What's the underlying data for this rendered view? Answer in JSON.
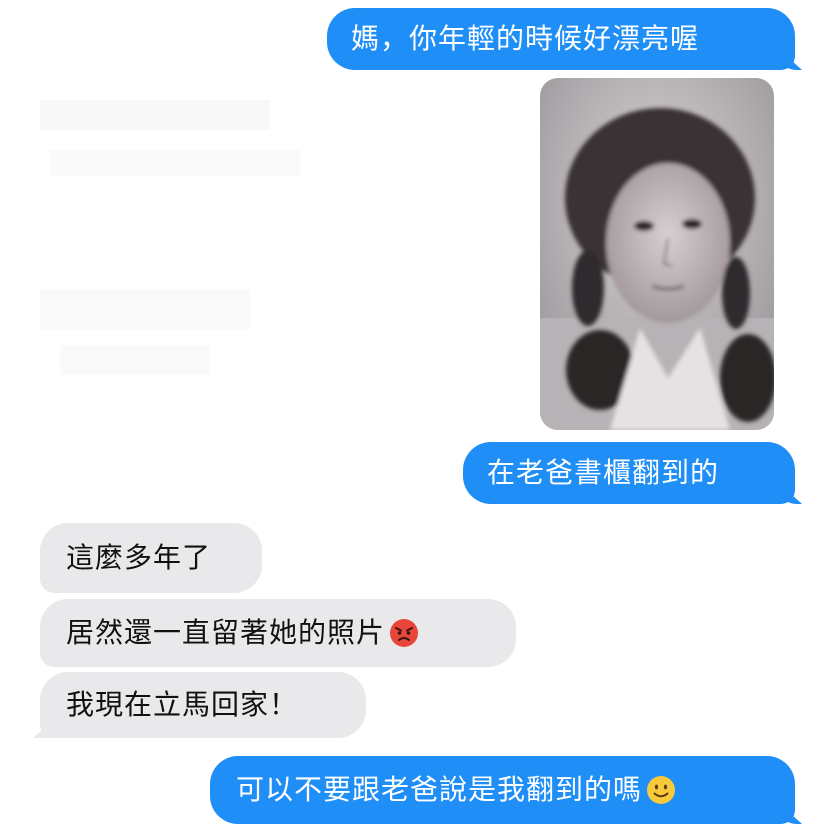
{
  "messages": [
    {
      "from": "me",
      "text": "媽，你年輕的時候好漂亮喔"
    },
    {
      "from": "me",
      "type": "photo",
      "image": "old black-and-white portrait of a young woman with braids"
    },
    {
      "from": "me",
      "text": "在老爸書櫃翻到的"
    },
    {
      "from": "mom",
      "text": "這麼多年了"
    },
    {
      "from": "mom",
      "text": "居然還一直留著她的照片",
      "emoji": "angry-face-emoji"
    },
    {
      "from": "mom",
      "text": "我現在立馬回家！"
    },
    {
      "from": "me",
      "text": "可以不要跟老爸說是我翻到的嗎",
      "emoji": "slightly-smiling-face-emoji"
    }
  ],
  "colors": {
    "outgoing_bubble": "#1f8ef7",
    "incoming_bubble": "#e9e9eb",
    "outgoing_text": "#ffffff",
    "incoming_text": "#111111"
  }
}
